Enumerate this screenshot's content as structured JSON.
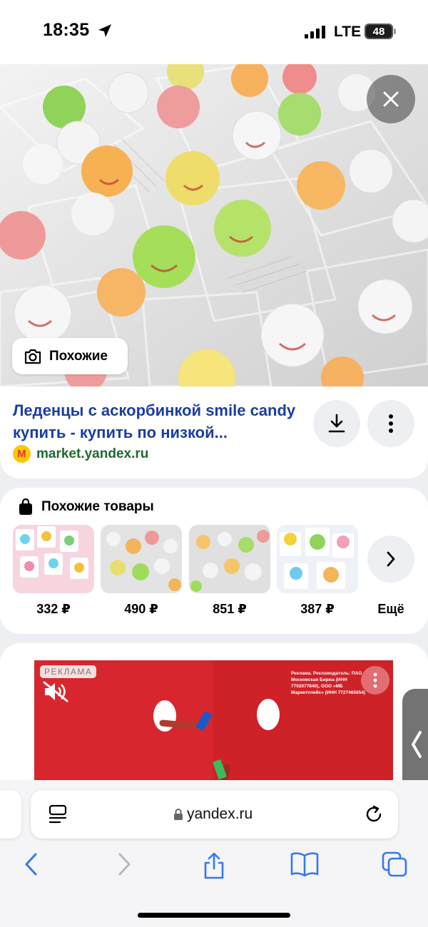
{
  "status_bar": {
    "time": "18:35",
    "network": "LTE",
    "battery": "48"
  },
  "hero": {
    "similar_button_label": "Похожие"
  },
  "result": {
    "title": "Леденцы с аскорбинкой smile candy купить - купить по низкой...",
    "source": "market.yandex.ru"
  },
  "similar_products": {
    "header": "Похожие товары",
    "items": [
      {
        "price": "332 ₽"
      },
      {
        "price": "490 ₽"
      },
      {
        "price": "851 ₽"
      },
      {
        "price": "387 ₽"
      }
    ],
    "more_label": "Ещё"
  },
  "ad": {
    "badge": "РЕКЛАМА",
    "disclaimer": "Реклама. Рекламодатель: ПАО Московская Биржа (ИНН 7702077840), ООО «МБ Маркетплейс» (ИНН 7727465654)"
  },
  "browser": {
    "url": "yandex.ru"
  },
  "colors": {
    "link": "#1a3fa0",
    "source": "#1e6b2c",
    "ad_background": "#d8262e",
    "ios_blue": "#3478f6"
  }
}
